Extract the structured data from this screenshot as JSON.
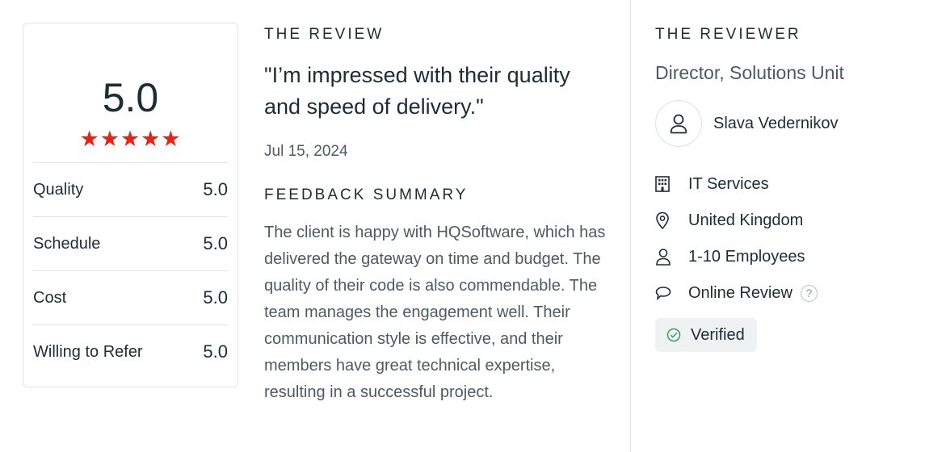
{
  "rating": {
    "overall": "5.0",
    "stars": "★★★★★",
    "rows": [
      {
        "label": "Quality",
        "value": "5.0"
      },
      {
        "label": "Schedule",
        "value": "5.0"
      },
      {
        "label": "Cost",
        "value": "5.0"
      },
      {
        "label": "Willing to Refer",
        "value": "5.0"
      }
    ]
  },
  "review": {
    "heading": "THE REVIEW",
    "quote": "\"I’m impressed with their quality and speed of delivery.\"",
    "date": "Jul 15, 2024",
    "summary_heading": "FEEDBACK SUMMARY",
    "summary": "The client is happy with HQSoftware, which has delivered the gateway on time and budget. The quality of their code is also commendable. The team manages the engagement well. Their communication style is effective, and their members have great technical expertise, resulting in a successful project."
  },
  "reviewer": {
    "heading": "THE REVIEWER",
    "title": "Director, Solutions Unit",
    "name": "Slava Vedernikov",
    "info": [
      {
        "icon": "building-icon",
        "text": "IT Services"
      },
      {
        "icon": "location-pin-icon",
        "text": "United Kingdom"
      },
      {
        "icon": "person-icon",
        "text": "1-10 Employees"
      },
      {
        "icon": "speech-bubble-icon",
        "text": "Online Review"
      }
    ],
    "help_glyph": "?",
    "verified_label": "Verified"
  },
  "colors": {
    "star": "#e62415",
    "text_dark": "#1d2d35",
    "text_muted": "#4d5a61",
    "border": "#dde3e7",
    "verified_bg": "#eff2f3",
    "verified_check": "#3a9c64"
  }
}
